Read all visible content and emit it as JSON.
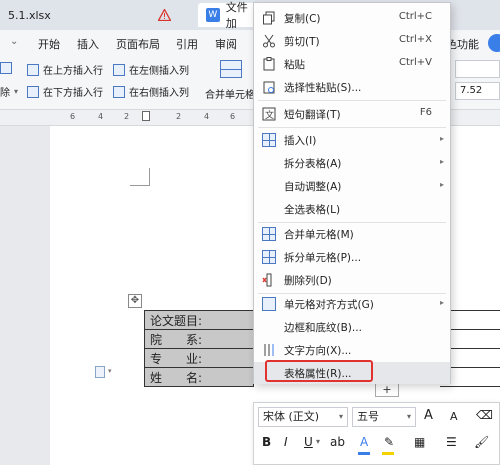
{
  "titlebar": {
    "tab_xlsx": "5.1.xlsx",
    "tab_doc": "文件加"
  },
  "ribbon": {
    "menus": [
      "开始",
      "插入",
      "页面布局",
      "引用",
      "审阅"
    ],
    "feature_label": "色功能",
    "insert_row_above": "在上方插入行",
    "insert_row_below": "在下方插入行",
    "insert_col_left": "在左侧插入列",
    "insert_col_right": "在右侧插入列",
    "merge_cells": "合并单元格",
    "truncated_left": "除",
    "field_value": "7.52"
  },
  "ruler": {
    "ticks": [
      "6",
      "4",
      "2",
      "2",
      "4",
      "6"
    ]
  },
  "form": {
    "rows": [
      "论文题目:",
      "院　　系:",
      "专　　业:",
      "姓　　名:"
    ]
  },
  "context_menu": {
    "items": [
      {
        "label": "复制(C)",
        "shortcut": "Ctrl+C",
        "icon": "copy-icon"
      },
      {
        "label": "剪切(T)",
        "shortcut": "Ctrl+X",
        "icon": "scissors-icon"
      },
      {
        "label": "粘贴",
        "shortcut": "Ctrl+V",
        "icon": "paste-icon"
      },
      {
        "label": "选择性粘贴(S)...",
        "shortcut": "",
        "icon": "paste-special-icon"
      },
      {
        "label": "短句翻译(T)",
        "shortcut": "F6",
        "icon": "translate-icon"
      },
      {
        "label": "插入(I)",
        "shortcut": "",
        "icon": "table-insert-icon",
        "submenu": true
      },
      {
        "label": "拆分表格(A)",
        "shortcut": "",
        "icon": "",
        "submenu": true
      },
      {
        "label": "自动调整(A)",
        "shortcut": "",
        "icon": "",
        "submenu": true
      },
      {
        "label": "全选表格(L)",
        "shortcut": "",
        "icon": ""
      },
      {
        "label": "合并单元格(M)",
        "shortcut": "",
        "icon": "merge-cells-icon"
      },
      {
        "label": "拆分单元格(P)...",
        "shortcut": "",
        "icon": "split-cells-icon"
      },
      {
        "label": "删除列(D)",
        "shortcut": "",
        "icon": "delete-column-icon"
      },
      {
        "label": "单元格对齐方式(G)",
        "shortcut": "",
        "icon": "cell-align-icon",
        "submenu": true
      },
      {
        "label": "边框和底纹(B)...",
        "shortcut": "",
        "icon": ""
      },
      {
        "label": "文字方向(X)...",
        "shortcut": "",
        "icon": "text-direction-icon"
      },
      {
        "label": "表格属性(R)...",
        "shortcut": "",
        "icon": ""
      }
    ]
  },
  "mini_toolbar": {
    "font_family": "宋体 (正文)",
    "font_size": "五号",
    "bold": "B",
    "italic": "I",
    "underline": "U",
    "font_grow": "A",
    "font_shrink": "A"
  },
  "colors": {
    "accent": "#3a7ee8",
    "highlight_border": "#e0322f",
    "cell_fill": "#c8c8c8"
  }
}
